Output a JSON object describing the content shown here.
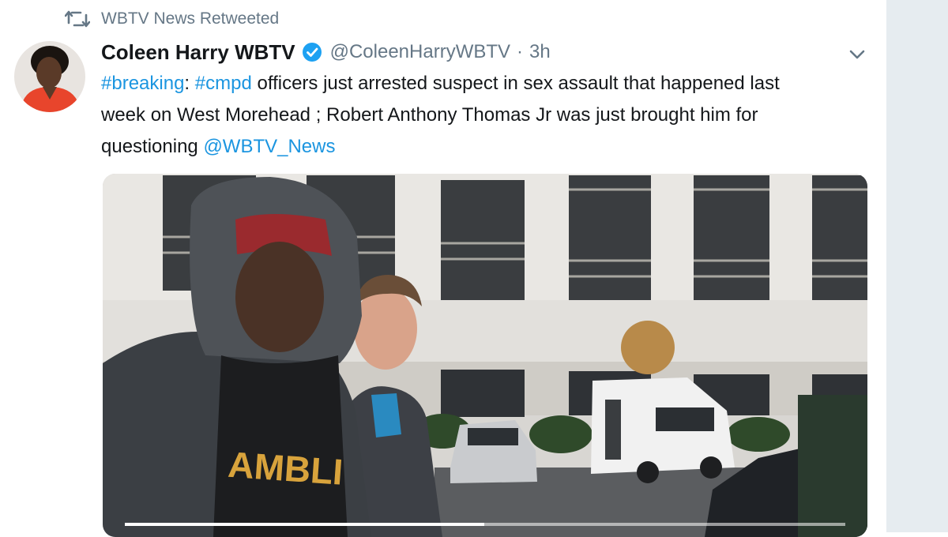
{
  "retweet": {
    "label": "WBTV News Retweeted"
  },
  "author": {
    "name": "Coleen Harry WBTV",
    "handle": "@ColeenHarryWBTV",
    "separator": "·",
    "time": "3h"
  },
  "tweet": {
    "hashtag1": "#breaking",
    "colon1": ":",
    "hashtag2": "#cmpd",
    "line1_rest": " officers just arrested suspect in sex assault that happened last",
    "line2": "week on West Morehead ; Robert Anthony Thomas Jr was just brought him for",
    "line3_start": "questioning ",
    "mention": "@WBTV_News"
  },
  "media": {
    "shirt_text": "AMBLI"
  },
  "colors": {
    "link": "#1b95e0",
    "name": "#14171a",
    "muted": "#657786",
    "gutter": "#e6ecf0"
  },
  "icons": {
    "retweet": "retweet-icon",
    "verified": "verified-badge-icon",
    "more": "chevron-down-icon"
  }
}
